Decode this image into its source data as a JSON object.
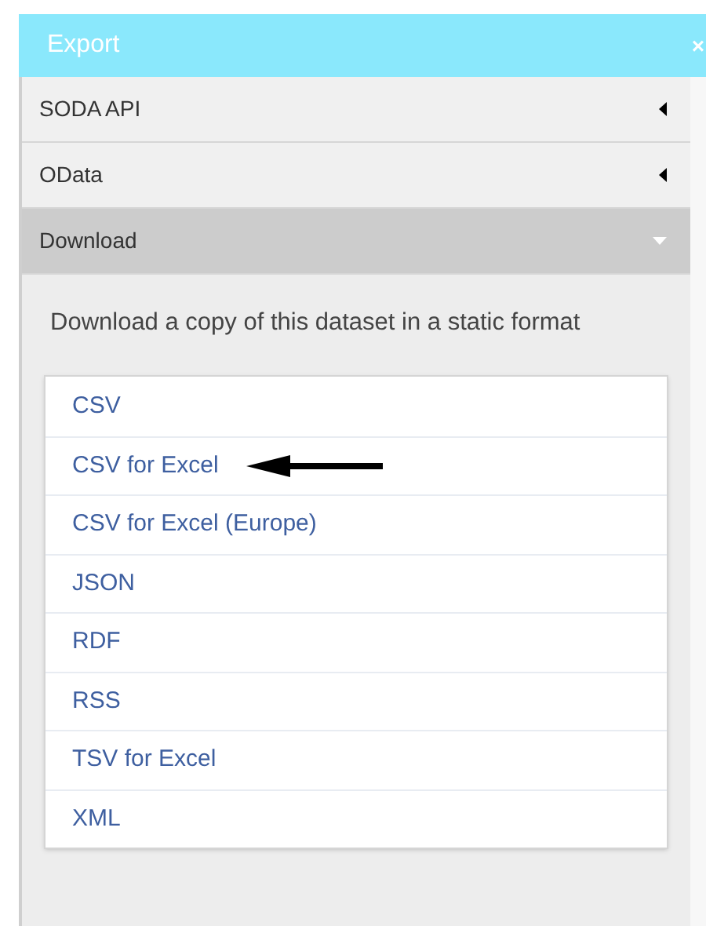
{
  "header": {
    "title": "Export",
    "close": "×"
  },
  "sections": [
    {
      "label": "SODA API",
      "expanded": false
    },
    {
      "label": "OData",
      "expanded": false
    },
    {
      "label": "Download",
      "expanded": true
    }
  ],
  "download": {
    "description": "Download a copy of this dataset in a static format",
    "formats": [
      {
        "label": "CSV",
        "pointed": false
      },
      {
        "label": "CSV for Excel",
        "pointed": true
      },
      {
        "label": "CSV for Excel (Europe)",
        "pointed": false
      },
      {
        "label": "JSON",
        "pointed": false
      },
      {
        "label": "RDF",
        "pointed": false
      },
      {
        "label": "RSS",
        "pointed": false
      },
      {
        "label": "TSV for Excel",
        "pointed": false
      },
      {
        "label": "XML",
        "pointed": false
      }
    ]
  }
}
